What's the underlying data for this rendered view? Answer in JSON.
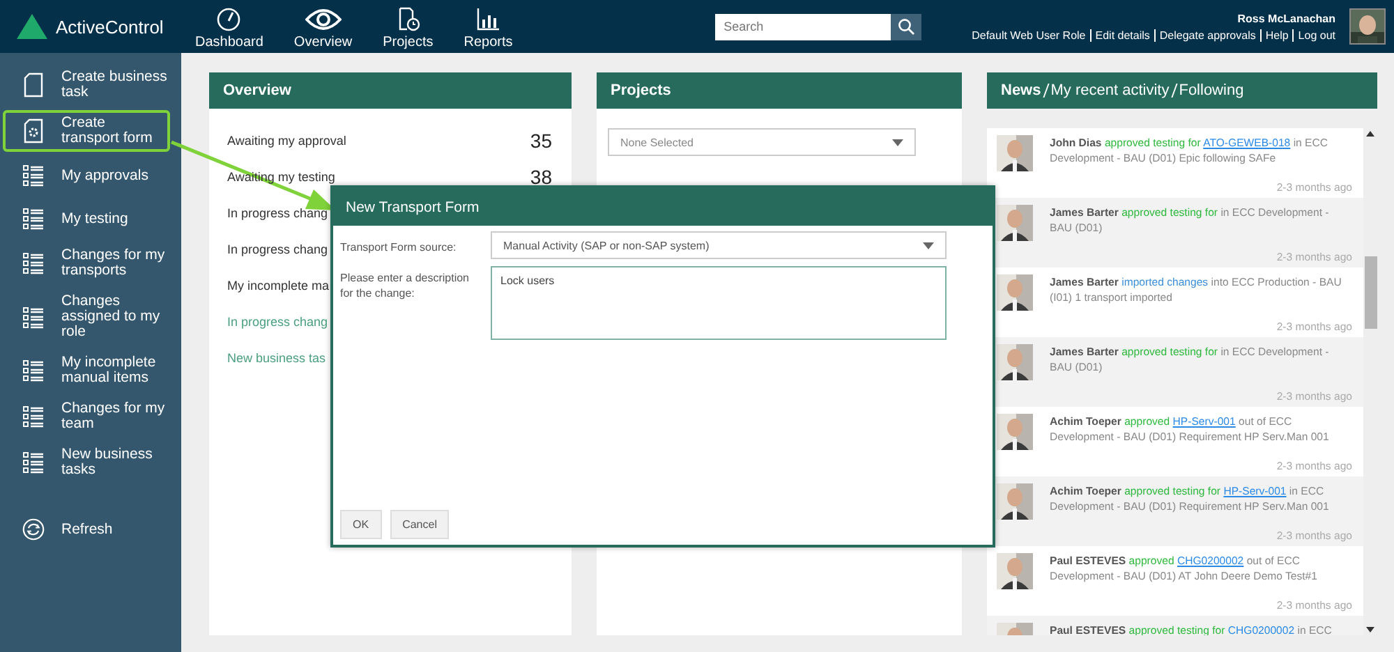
{
  "header": {
    "logo": "ActiveControl",
    "nav": [
      {
        "label": "Dashboard"
      },
      {
        "label": "Overview"
      },
      {
        "label": "Projects"
      },
      {
        "label": "Reports"
      }
    ],
    "search": {
      "placeholder": "Search"
    },
    "user": {
      "name": "Ross McLanachan",
      "links": [
        "Default Web User Role",
        "Edit details",
        "Delegate approvals",
        "Help",
        "Log out"
      ]
    }
  },
  "sidebar": {
    "items": [
      {
        "label": "Create business task",
        "selected": false
      },
      {
        "label": "Create transport form",
        "selected": true
      },
      {
        "label": "My approvals",
        "selected": false
      },
      {
        "label": "My testing",
        "selected": false
      },
      {
        "label": "Changes for my transports",
        "selected": false
      },
      {
        "label": "Changes assigned to my role",
        "selected": false
      },
      {
        "label": "My incomplete manual items",
        "selected": false
      },
      {
        "label": "Changes for my team",
        "selected": false
      },
      {
        "label": "New business tasks",
        "selected": false
      }
    ],
    "refresh": "Refresh"
  },
  "overview": {
    "title": "Overview",
    "rows": [
      {
        "label": "Awaiting my approval",
        "count": "35",
        "kind": "count"
      },
      {
        "label": "Awaiting my testing",
        "count": "38",
        "kind": "count"
      },
      {
        "label": "In progress chang",
        "kind": "count"
      },
      {
        "label": "In progress chang",
        "kind": "count"
      },
      {
        "label": "My incomplete ma",
        "kind": "count"
      },
      {
        "label": "In progress chang",
        "kind": "link"
      },
      {
        "label": "New business tas",
        "kind": "link"
      }
    ]
  },
  "projects": {
    "title": "Projects",
    "filter": "None Selected"
  },
  "news": {
    "title_parts": [
      "News",
      "My recent activity",
      "Following"
    ],
    "items": [
      {
        "user": "John Dias",
        "action": "approved testing for",
        "kind": "approval",
        "link": "ATO-GEWEB-018",
        "text": "in ECC Development - BAU (D01) Epic following SAFe",
        "time": "2-3 months ago"
      },
      {
        "user": "James Barter",
        "action": "approved testing for",
        "kind": "approval",
        "text": "in ECC Development - BAU (D01)",
        "time": "2-3 months ago"
      },
      {
        "user": "James Barter",
        "action": "imported changes",
        "kind": "import",
        "text": "into ECC Production - BAU (I01)  1 transport imported",
        "time": "2-3 months ago"
      },
      {
        "user": "James Barter",
        "action": "approved testing for",
        "kind": "approval",
        "text": "in ECC Development - BAU (D01)",
        "time": "2-3 months ago"
      },
      {
        "user": "Achim Toeper",
        "action": "approved",
        "kind": "approval",
        "link": "HP-Serv-001",
        "text": "out of ECC Development - BAU (D01) Requirement HP Serv.Man 001",
        "time": "2-3 months ago"
      },
      {
        "user": "Achim Toeper",
        "action": "approved testing for",
        "kind": "approval",
        "link": "HP-Serv-001",
        "text": "in ECC Development - BAU (D01) Requirement HP Serv.Man 001",
        "time": "2-3 months ago"
      },
      {
        "user": "Paul ESTEVES",
        "action": "approved",
        "kind": "approval",
        "link": "CHG0200002",
        "text": "out of ECC Development - BAU (D01) AT John Deere Demo Test#1",
        "time": "2-3 months ago"
      },
      {
        "user": "Paul ESTEVES",
        "action": "approved testing for",
        "kind": "approval",
        "link": "CHG0200002",
        "text": "in ECC"
      }
    ]
  },
  "dialog": {
    "title": "New Transport Form",
    "source_label": "Transport Form source:",
    "source_value": "Manual Activity (SAP or non-SAP system)",
    "description_label": "Please enter a description for the change:",
    "description_value": "Lock users",
    "buttons": [
      "OK",
      "Cancel"
    ]
  }
}
